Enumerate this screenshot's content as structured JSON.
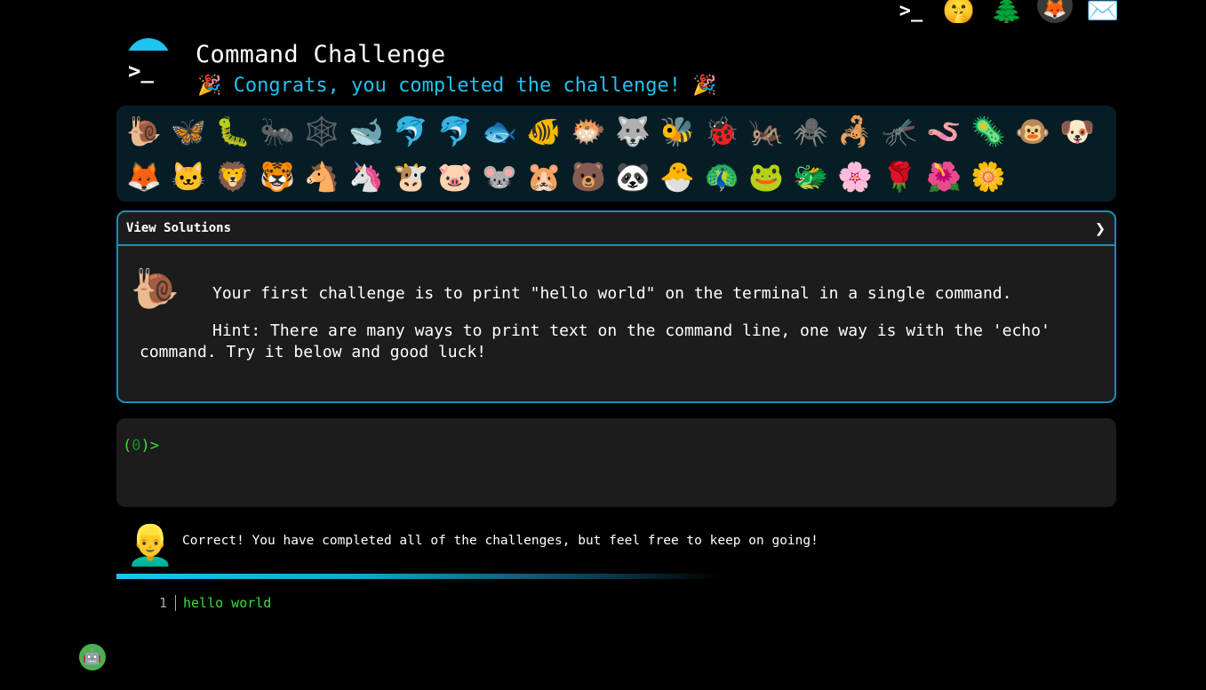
{
  "top_icons": [
    {
      "name": "terminal-icon",
      "glyph": ">_"
    },
    {
      "name": "shushing-face-icon",
      "glyph": "🤫"
    },
    {
      "name": "christmas-tree-icon",
      "glyph": "🌲"
    },
    {
      "name": "gitlab-icon",
      "glyph": "🦊"
    },
    {
      "name": "envelope-icon",
      "glyph": "✉️"
    }
  ],
  "header": {
    "logo_prompt": ">_",
    "title": "Command Challenge",
    "congrats_party_left": "🎉",
    "congrats_text": "Congrats, you completed the challenge!",
    "congrats_party_right": "🎉"
  },
  "emoji_bar": [
    "🐌",
    "🦋",
    "🐛",
    "🐜",
    "🕸️",
    "🐋",
    "🐬",
    "🐬",
    "🐟",
    "🐠",
    "🐡",
    "🐺",
    "🐝",
    "🐞",
    "🦗",
    "🕷️",
    "🦂",
    "🦟",
    "🪱",
    "🦠",
    "🐵",
    "🐶",
    "🦊",
    "🐱",
    "🦁",
    "🐯",
    "🐴",
    "🦄",
    "🐮",
    "🐷",
    "🐭",
    "🐹",
    "🐻",
    "🐼",
    "🐣",
    "🦚",
    "🐸",
    "🐲",
    "🌸",
    "🌹",
    "🌺",
    "🌼"
  ],
  "challenge": {
    "solutions_label": "View Solutions",
    "chevron": "❯",
    "icon": "🐌",
    "text": "Your first challenge is to print \"hello world\" on the terminal in a single command.",
    "hint": "Hint: There are many ways to print text on the command line, one way is with the 'echo' command. Try it below and good luck!"
  },
  "terminal": {
    "prompt_open": "(",
    "prompt_count": "0",
    "prompt_close": ")>"
  },
  "feedback": {
    "avatar": "👱‍♂️",
    "message": "Correct! You have completed all of the challenges, but feel free to keep on going!"
  },
  "output": {
    "line_number": "1",
    "text": "hello world"
  },
  "bot": {
    "glyph": "🤖"
  },
  "colors": {
    "accent": "#1ec3f0",
    "terminal_green": "#36e236",
    "panel_bg": "#1c1c1c",
    "emoji_bar_bg": "#071d25",
    "border": "#1a8fb8"
  }
}
